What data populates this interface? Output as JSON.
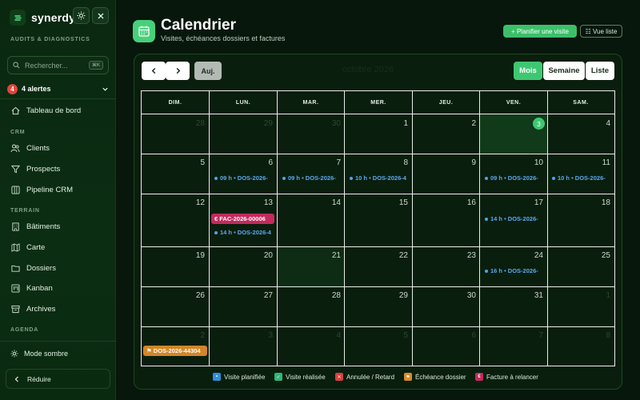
{
  "brand": {
    "name": "synerdys"
  },
  "sidebar": {
    "section_audits": "AUDITS & DIAGNOSTICS",
    "search_placeholder": "Rechercher...",
    "search_shortcut": "⌘K",
    "alerts": {
      "count": "4",
      "label": "4 alertes"
    },
    "dashboard": "Tableau de bord",
    "section_crm": "CRM",
    "clients": "Clients",
    "prospects": "Prospects",
    "pipeline": "Pipeline CRM",
    "section_terrain": "TERRAIN",
    "batiments": "Bâtiments",
    "carte": "Carte",
    "dossiers": "Dossiers",
    "kanban": "Kanban",
    "archives": "Archives",
    "section_agenda": "AGENDA",
    "dark_mode": "Mode sombre",
    "reduce": "Réduire"
  },
  "header": {
    "title": "Calendrier",
    "subtitle": "Visites, échéances dossiers et factures",
    "plan_button": "+ Planifier une visite",
    "list_button": "☷ Vue liste"
  },
  "toolbar": {
    "today": "Auj.",
    "month_title": "octobre 2026",
    "views": [
      "Mois",
      "Semaine",
      "Liste"
    ],
    "active_view": "Mois"
  },
  "calendar": {
    "weekdays": [
      "DIM.",
      "LUN.",
      "MAR.",
      "MER.",
      "JEU.",
      "VEN.",
      "SAM."
    ],
    "weeks": [
      [
        "28",
        "29",
        "30",
        "1",
        "2",
        "3",
        "4"
      ],
      [
        "5",
        "6",
        "7",
        "8",
        "9",
        "10",
        "11"
      ],
      [
        "12",
        "13",
        "14",
        "15",
        "16",
        "17",
        "18"
      ],
      [
        "19",
        "20",
        "21",
        "22",
        "23",
        "24",
        "25"
      ],
      [
        "26",
        "27",
        "28",
        "29",
        "30",
        "31",
        "1"
      ],
      [
        "2",
        "3",
        "4",
        "5",
        "6",
        "7",
        "8"
      ]
    ],
    "today": "3",
    "events": {
      "w1_mon": "09 h • DOS-2026-",
      "w1_tue": "09 h • DOS-2026-",
      "w1_wed": "10 h • DOS-2026-4",
      "w1_fri": "09 h • DOS-2026-",
      "w1_sat": "10 h • DOS-2026-",
      "w2_mon_invoice": "€ FAC-2026-00006",
      "w2_mon_visit": "14 h • DOS-2026-4",
      "w2_fri": "14 h • DOS-2026-",
      "w3_fri": "16 h • DOS-2026-",
      "w5_sun_due": "⚑ DOS-2026-44304"
    }
  },
  "legend": [
    {
      "label": "Visite planifiée",
      "color": "#2f8fd8",
      "glyph": "•"
    },
    {
      "label": "Visite réalisée",
      "color": "#2fb57a",
      "glyph": "✓"
    },
    {
      "label": "Annulée / Retard",
      "color": "#d8403c",
      "glyph": "✕"
    },
    {
      "label": "Échéance dossier",
      "color": "#d98a28",
      "glyph": "⚑"
    },
    {
      "label": "Facture à relancer",
      "color": "#c42a5e",
      "glyph": "€"
    }
  ]
}
